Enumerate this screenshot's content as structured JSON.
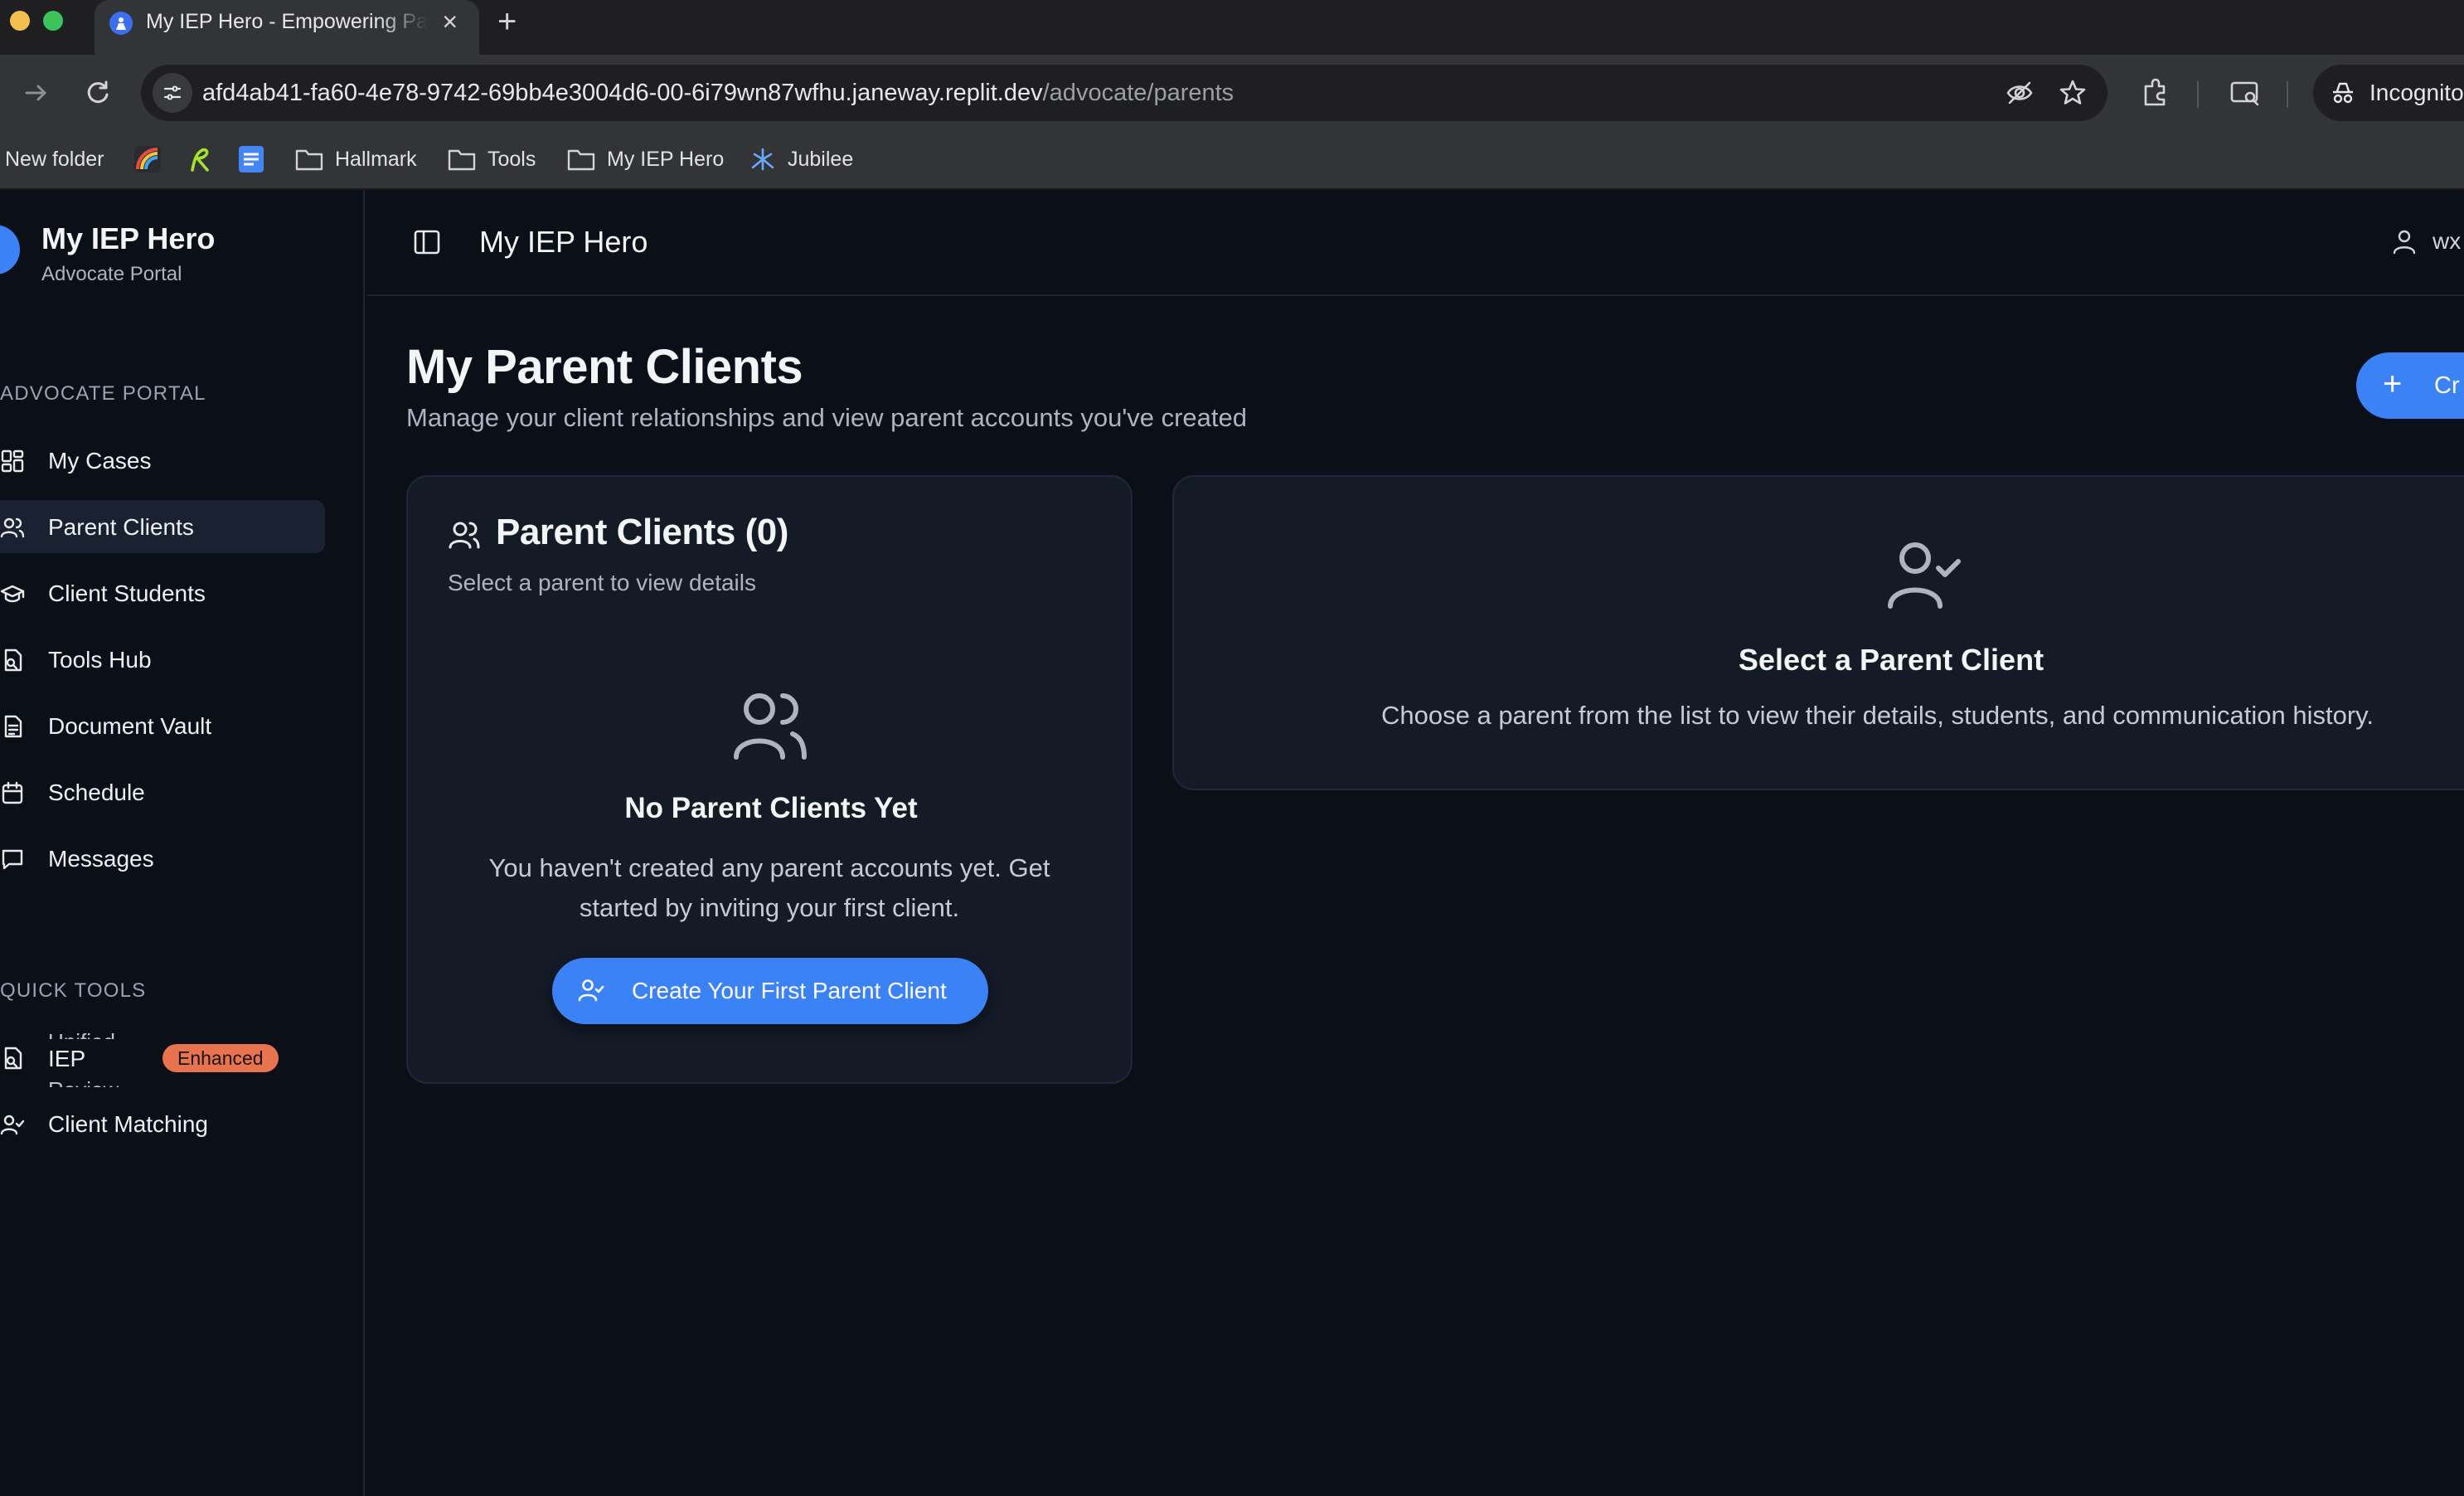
{
  "browser": {
    "tab_title": "My IEP Hero - Empowering Pa",
    "tab_close": "×",
    "new_tab": "+",
    "url_host": "afd4ab41-fa60-4e78-9742-69bb4e3004d6-00-6i79wn87wfhu.janeway.replit.dev",
    "url_path": "/advocate/parents",
    "profile_label": "Incognito",
    "bookmarks": [
      "New folder",
      "Hallmark",
      "Tools",
      "My IEP Hero",
      "Jubilee"
    ]
  },
  "sidebar": {
    "brand_title": "My IEP Hero",
    "brand_subtitle": "Advocate Portal",
    "section_portal": "ADVOCATE PORTAL",
    "nav": [
      {
        "label": "My Cases"
      },
      {
        "label": "Parent Clients"
      },
      {
        "label": "Client Students"
      },
      {
        "label": "Tools Hub"
      },
      {
        "label": "Document Vault"
      },
      {
        "label": "Schedule"
      },
      {
        "label": "Messages"
      }
    ],
    "section_tools": "QUICK TOOLS",
    "tools": [
      {
        "label": "IEP",
        "ghost_above": "Unified",
        "ghost_below": "Review",
        "badge": "Enhanced"
      },
      {
        "label": "Client Matching"
      }
    ]
  },
  "topbar": {
    "title": "My IEP Hero",
    "user": "wx"
  },
  "main": {
    "title": "My Parent Clients",
    "subtitle": "Manage your client relationships and view parent accounts you've created",
    "create_button": "Cr"
  },
  "left_card": {
    "title": "Parent Clients (0)",
    "subtitle": "Select a parent to view details",
    "empty_title": "No Parent Clients Yet",
    "empty_description": "You haven't created any parent accounts yet. Get started by inviting your first client.",
    "button_label": "Create Your First Parent Client"
  },
  "right_card": {
    "title": "Select a Parent Client",
    "description": "Choose a parent from the list to view their details, students, and communication history."
  },
  "colors": {
    "accent": "#3b82f6",
    "background": "#0b0f17",
    "card": "#141b27",
    "badge": "#e8734f"
  }
}
